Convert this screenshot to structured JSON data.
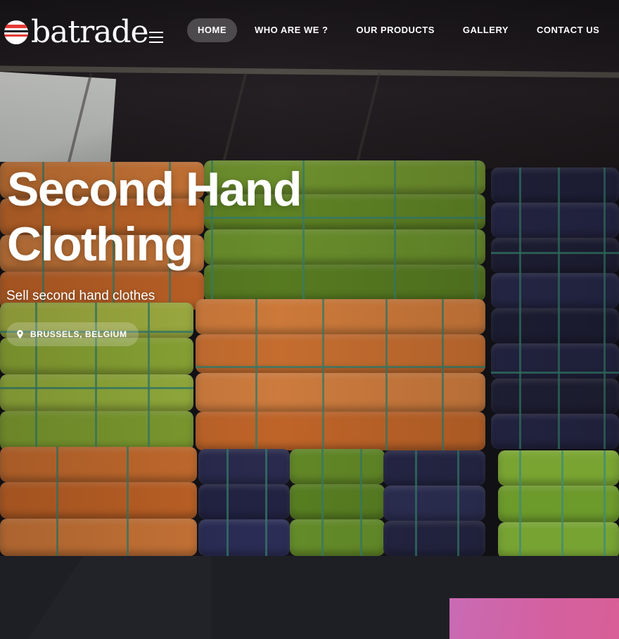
{
  "brand": {
    "name": "batrade",
    "logo_colors": [
      "#e53935",
      "#ffffff"
    ]
  },
  "nav": {
    "items": [
      {
        "label": "HOME",
        "active": true
      },
      {
        "label": "WHO ARE WE ?",
        "active": false
      },
      {
        "label": "OUR PRODUCTS",
        "active": false
      },
      {
        "label": "GALLERY",
        "active": false
      },
      {
        "label": "CONTACT US",
        "active": false
      }
    ],
    "menu_icon": "hamburger-icon"
  },
  "hero": {
    "title": "Second Hand Clothing",
    "subtitle": "Sell second hand clothes",
    "location": {
      "icon": "map-pin-icon",
      "label": "BRUSSELS, BELGIUM"
    }
  },
  "colors": {
    "nav_active_bg": "rgba(255,255,255,0.22)",
    "lower_bg": "#1e1f25",
    "accent_pink": "#d4609f",
    "bale_orange": "#e07a34",
    "bale_green": "#6f9a2c",
    "bale_navy": "#2b2c4f",
    "strap_teal": "#3c8c78"
  }
}
